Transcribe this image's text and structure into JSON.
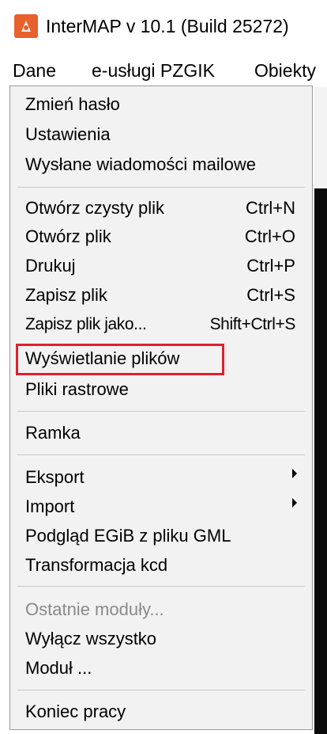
{
  "window": {
    "title": "InterMAP v 10.1 (Build 25272)"
  },
  "menubar": {
    "items": [
      "Dane",
      "e-usługi PZGIK",
      "Obiekty"
    ]
  },
  "dropdown": {
    "items": [
      {
        "label": "Zmień hasło"
      },
      {
        "label": "Ustawienia"
      },
      {
        "label": "Wysłane wiadomości mailowe"
      },
      {
        "label": "Otwórz czysty plik",
        "shortcut": "Ctrl+N"
      },
      {
        "label": "Otwórz plik",
        "shortcut": "Ctrl+O"
      },
      {
        "label": "Drukuj",
        "shortcut": "Ctrl+P"
      },
      {
        "label": "Zapisz plik",
        "shortcut": "Ctrl+S"
      },
      {
        "label": "Zapisz plik jako...",
        "shortcut": "Shift+Ctrl+S"
      },
      {
        "label": "Wyświetlanie plików"
      },
      {
        "label": "Pliki rastrowe"
      },
      {
        "label": "Ramka"
      },
      {
        "label": "Eksport"
      },
      {
        "label": "Import"
      },
      {
        "label": "Podgląd EGiB z pliku GML"
      },
      {
        "label": "Transformacja kcd"
      },
      {
        "label": "Ostatnie moduły..."
      },
      {
        "label": "Wyłącz wszystko"
      },
      {
        "label": "Moduł ..."
      },
      {
        "label": "Koniec pracy"
      }
    ]
  },
  "colors": {
    "highlight_border": "#e0202e",
    "app_icon": "#e8602c",
    "menu_bg": "#f2f2f2"
  }
}
